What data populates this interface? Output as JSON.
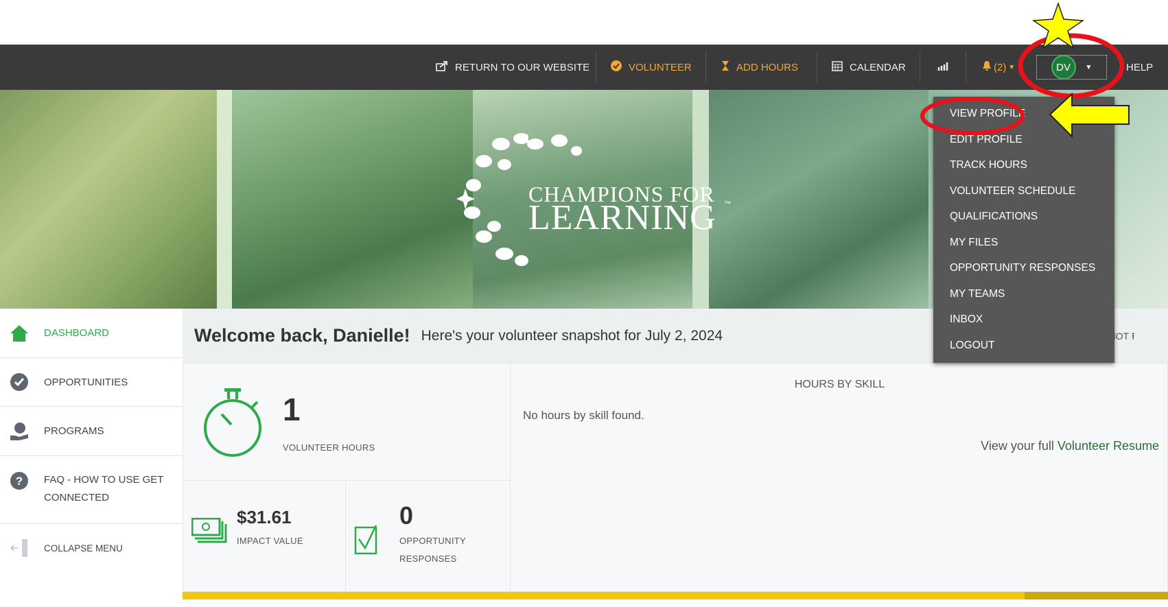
{
  "nav": {
    "return_label": "RETURN TO OUR WEBSITE",
    "volunteer_label": "VOLUNTEER",
    "add_hours_label": "ADD HOURS",
    "calendar_label": "CALENDAR",
    "notifications_label": "(2)",
    "avatar_initials": "DV",
    "help_label": "HELP"
  },
  "banner": {
    "logo_line1": "CHAMPIONS FOR",
    "logo_line2": "LEARNING",
    "logo_tm": "™"
  },
  "user_menu": {
    "items": [
      "VIEW PROFILE",
      "EDIT PROFILE",
      "TRACK HOURS",
      "VOLUNTEER SCHEDULE",
      "QUALIFICATIONS",
      "MY FILES",
      "OPPORTUNITY RESPONSES",
      "MY TEAMS",
      "INBOX",
      "LOGOUT"
    ]
  },
  "sidebar": {
    "items": [
      {
        "label": "DASHBOARD"
      },
      {
        "label": "OPPORTUNITIES"
      },
      {
        "label": "PROGRAMS"
      },
      {
        "label": "FAQ - HOW TO USE GET CONNECTED"
      },
      {
        "label": "COLLAPSE MENU"
      }
    ]
  },
  "main": {
    "welcome": "Welcome back, Danielle!",
    "snapshot_text": "Here's your volunteer snapshot for July 2, 2024",
    "share_snapshot": "SHARE SNAPSHOT",
    "volunteer_hours": "1",
    "volunteer_hours_label": "VOLUNTEER HOURS",
    "impact_value": "$31.61",
    "impact_value_label": "IMPACT VALUE",
    "opportunity_responses": "0",
    "opportunity_responses_label": "OPPORTUNITY RESPONSES",
    "hours_by_skill_title": "HOURS BY SKILL",
    "no_hours_text": "No hours by skill found.",
    "resume_prefix": "View your full",
    "resume_link": "Volunteer Resume"
  },
  "colors": {
    "green": "#2eaa4a",
    "orange": "#f0a830",
    "nav_bg": "#3a3a3a",
    "yellow_bar": "#f2c80f",
    "annotation_red": "#e8121b",
    "annotation_yellow": "#ffff00"
  }
}
